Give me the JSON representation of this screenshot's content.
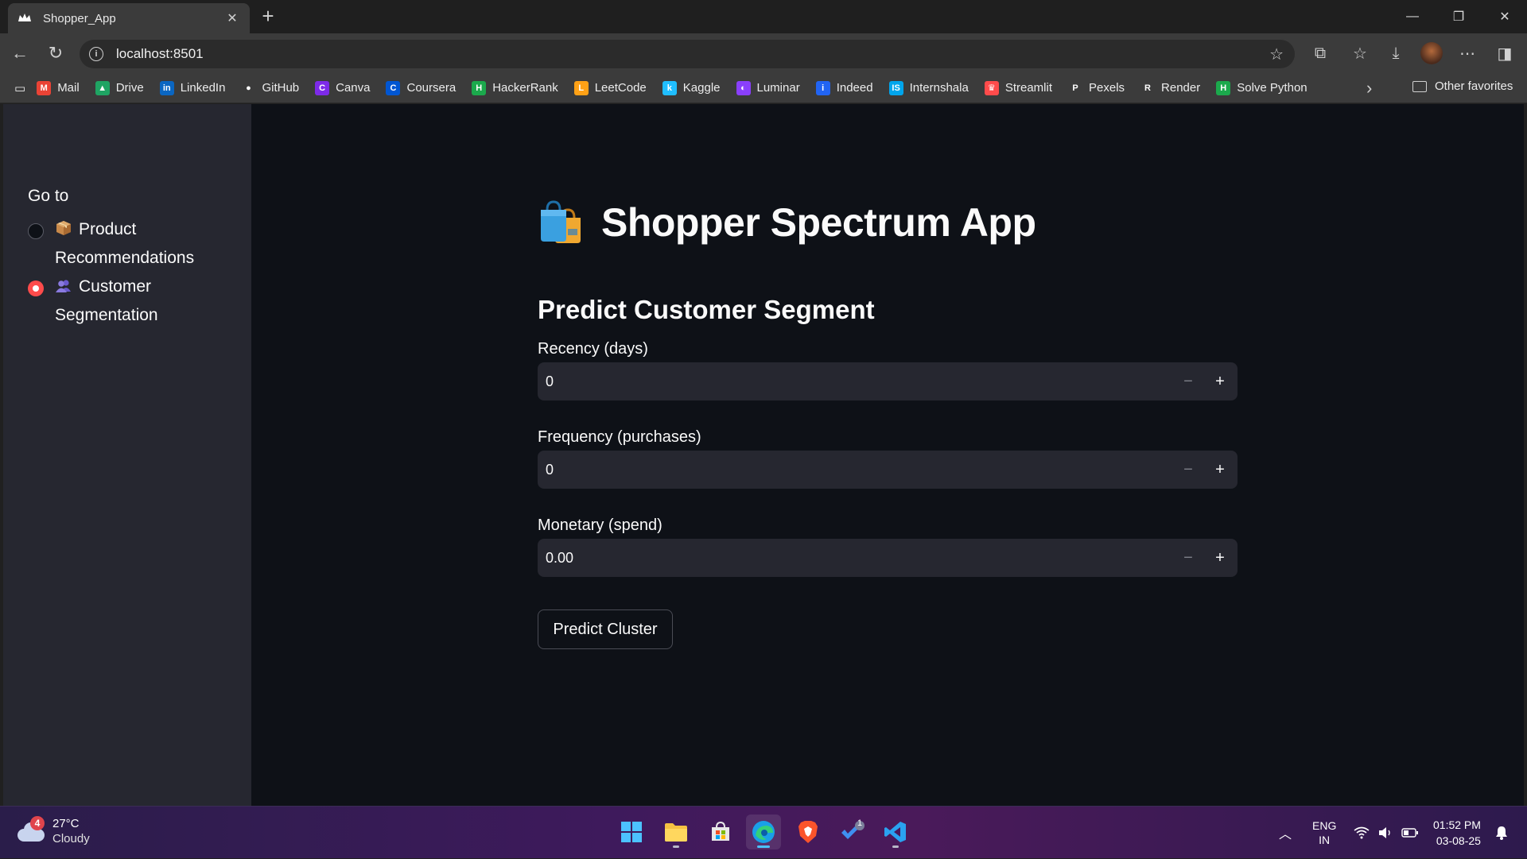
{
  "browser": {
    "tab_title": "Shopper_App",
    "url": "localhost:8501",
    "bookmarks": [
      {
        "label": "Mail",
        "icon": "gmail-icon",
        "color": "#ea4335"
      },
      {
        "label": "Drive",
        "icon": "drive-icon",
        "color": "#1fa463"
      },
      {
        "label": "LinkedIn",
        "icon": "linkedin-icon",
        "color": "#0a66c2"
      },
      {
        "label": "GitHub",
        "icon": "github-icon",
        "color": "#ffffff"
      },
      {
        "label": "Canva",
        "icon": "canva-icon",
        "color": "#7d2ae8"
      },
      {
        "label": "Coursera",
        "icon": "coursera-icon",
        "color": "#0056d2"
      },
      {
        "label": "HackerRank",
        "icon": "hackerrank-icon",
        "color": "#1ba94c"
      },
      {
        "label": "LeetCode",
        "icon": "leetcode-icon",
        "color": "#ffa116"
      },
      {
        "label": "Kaggle",
        "icon": "kaggle-icon",
        "color": "#20beff"
      },
      {
        "label": "Luminar",
        "icon": "luminar-icon",
        "color": "#8a3ffc"
      },
      {
        "label": "Indeed",
        "icon": "indeed-icon",
        "color": "#2164f3"
      },
      {
        "label": "Internshala",
        "icon": "internshala-icon",
        "color": "#00a5ec"
      },
      {
        "label": "Streamlit",
        "icon": "streamlit-icon",
        "color": "#ff4b4b"
      },
      {
        "label": "Pexels",
        "icon": "pexels-icon",
        "color": "#ffffff"
      },
      {
        "label": "Render",
        "icon": "render-icon",
        "color": "#ffffff"
      },
      {
        "label": "Solve Python",
        "icon": "hackerrank-icon",
        "color": "#1ba94c"
      }
    ],
    "other_favorites": "Other favorites"
  },
  "sidebar": {
    "label": "Go to",
    "options": [
      {
        "emoji": "package-icon",
        "label": "Product Recommendations",
        "selected": false
      },
      {
        "emoji": "people-icon",
        "label": "Customer Segmentation",
        "selected": true
      }
    ]
  },
  "main": {
    "title": "Shopper Spectrum App",
    "title_icon": "shopping-bags-icon",
    "subheader": "Predict Customer Segment",
    "fields": [
      {
        "label": "Recency (days)",
        "value": "0"
      },
      {
        "label": "Frequency (purchases)",
        "value": "0"
      },
      {
        "label": "Monetary (spend)",
        "value": "0.00"
      }
    ],
    "button_label": "Predict Cluster"
  },
  "taskbar": {
    "weather_temp": "27°C",
    "weather_desc": "Cloudy",
    "weather_badge": "4",
    "lang_top": "ENG",
    "lang_bottom": "IN",
    "time": "01:52 PM",
    "date": "03-08-25"
  },
  "colors": {
    "accent": "#ff4b4b",
    "app_bg": "#0e1117",
    "sidebar_bg": "#262730",
    "input_bg": "#262730"
  }
}
